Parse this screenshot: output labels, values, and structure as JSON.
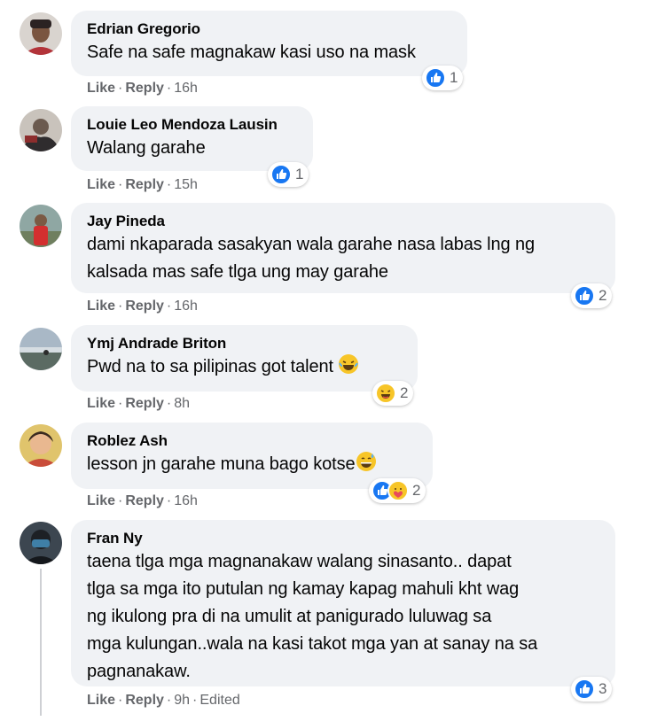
{
  "actions": {
    "like": "Like",
    "reply": "Reply",
    "dot": "·"
  },
  "colors": {
    "like_blue": "#1877f2",
    "bubble": "#f0f2f5",
    "meta": "#65676b",
    "haha_yellow": "#f7c528"
  },
  "comments": [
    {
      "author": "Edrian Gregorio",
      "lines": [
        "Safe na safe magnakaw kasi uso na mask"
      ],
      "time": "16h",
      "reactions": {
        "icons": [
          "like-icon"
        ],
        "count": "1"
      }
    },
    {
      "author": "Louie Leo Mendoza Lausin",
      "lines": [
        "Walang garahe"
      ],
      "time": "15h",
      "reactions": {
        "icons": [
          "like-icon"
        ],
        "count": "1"
      }
    },
    {
      "author": "Jay Pineda",
      "lines": [
        "dami nkaparada sasakyan wala garahe nasa labas lng ng",
        "kalsada mas safe tlga ung may garahe"
      ],
      "time": "16h",
      "reactions": {
        "icons": [
          "like-icon"
        ],
        "count": "2"
      }
    },
    {
      "author": "Ymj Andrade Briton",
      "lines": [
        "Pwd na to sa pilipinas got talent"
      ],
      "time": "8h",
      "reactions": {
        "icons": [
          "haha-icon"
        ],
        "count": "2"
      }
    },
    {
      "author": "Roblez Ash",
      "lines": [
        "lesson jn garahe muna bago kotse"
      ],
      "time": "16h",
      "reactions": {
        "icons": [
          "like-icon",
          "care-icon"
        ],
        "count": "2"
      }
    },
    {
      "author": "Fran Ny",
      "lines": [
        "taena tlga mga magnanakaw walang sinasanto.. dapat",
        "tlga sa mga ito putulan ng kamay kapag mahuli kht wag",
        "ng ikulong pra di na umulit at panigurado luluwag sa",
        "mga kulungan..wala na kasi takot mga yan at sanay na sa",
        "pagnanakaw."
      ],
      "time": "9h",
      "edited": "Edited",
      "reactions": {
        "icons": [
          "like-icon"
        ],
        "count": "3"
      }
    }
  ]
}
